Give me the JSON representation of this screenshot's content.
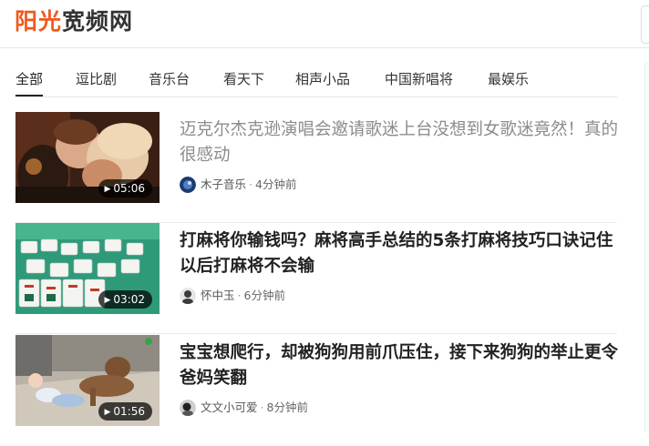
{
  "header": {
    "logo_part1": "阳光",
    "logo_part2": "宽频网"
  },
  "tabs": [
    {
      "label": "全部",
      "active": true
    },
    {
      "label": "逗比剧",
      "active": false
    },
    {
      "label": "音乐台",
      "active": false
    },
    {
      "label": "看天下",
      "active": false
    },
    {
      "label": "相声小品",
      "active": false
    },
    {
      "label": "中国新唱将",
      "active": false
    },
    {
      "label": "最娱乐",
      "active": false
    }
  ],
  "videos": [
    {
      "title": "迈克尔杰克逊演唱会邀请歌迷上台没想到女歌迷竟然！真的很感动",
      "duration": "05:06",
      "author": "木子音乐",
      "time": "4分钟前",
      "visited": true
    },
    {
      "title": "打麻将你输钱吗？麻将高手总结的5条打麻将技巧口诀记住以后打麻将不会输",
      "duration": "03:02",
      "author": "怀中玉",
      "time": "6分钟前",
      "visited": false
    },
    {
      "title": "宝宝想爬行，却被狗狗用前爪压住，接下来狗狗的举止更令爸妈笑翻",
      "duration": "01:56",
      "author": "文文小可爱",
      "time": "8分钟前",
      "visited": false
    }
  ],
  "meta_separator": "·",
  "icons": {
    "play": "play-triangle"
  },
  "colors": {
    "brand_orange": "#ef5a1d",
    "read_title": "#8c8c8c"
  }
}
